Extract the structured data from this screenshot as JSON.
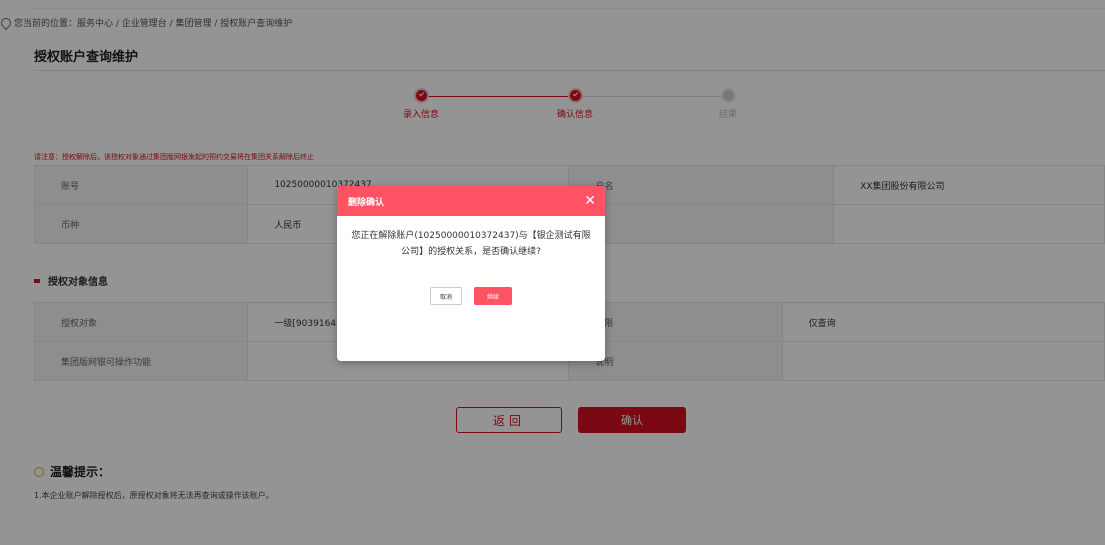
{
  "breadcrumb": {
    "text": "您当前的位置：服务中心 / 企业管理台 / 集团管理 / 授权账户查询维护"
  },
  "page_title": "授权账户查询维护",
  "steps": [
    {
      "label": "录入信息",
      "state": "done"
    },
    {
      "label": "确认信息",
      "state": "active"
    },
    {
      "label": "结果",
      "state": "pending"
    }
  ],
  "notice": "请注意：授权解除后，该授权对象通过集团版网银发起的预约交易将在集团关系解除后终止",
  "account_table": {
    "rows": [
      {
        "k1": "账号",
        "v1": "10250000010372437",
        "k2": "户名",
        "v2": "XX集团股份有限公司"
      },
      {
        "k1": "币种",
        "v1": "人民币",
        "k2": "",
        "v2": ""
      }
    ]
  },
  "section": {
    "title": "授权对象信息"
  },
  "auth_table": {
    "rows": [
      {
        "k1": "授权对象",
        "v1": "一级[903916438]根",
        "k2": "权限",
        "v2": "仅查询"
      },
      {
        "k1": "集团版网银可操作功能",
        "v1": "",
        "k2": "说明",
        "v2": ""
      }
    ]
  },
  "buttons": {
    "back": "返回",
    "confirm": "确认"
  },
  "tips": {
    "title": "温馨提示：",
    "text": "1.本企业账户解除授权后，原授权对象将无法再查询或操作该账户。"
  },
  "modal": {
    "title": "删除确认",
    "message": "您正在解除账户(10250000010372437)与【银企测试有限公司】的授权关系，是否确认继续?",
    "cancel": "取消",
    "ok": "继续"
  },
  "colors": {
    "brand_red": "#d40f1f",
    "modal_red": "#ff5364"
  }
}
